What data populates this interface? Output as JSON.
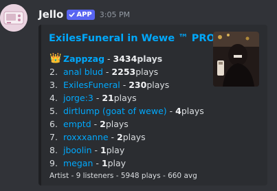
{
  "author": {
    "name": "Jello",
    "badge": "APP",
    "timestamp": "3:05 PM"
  },
  "embed": {
    "title": "ExilesFuneral in Wewe ™ PRO",
    "rows": [
      {
        "rank": "👑",
        "user": "Zappzag",
        "sep": " - ",
        "count": "3434",
        "unit": " plays"
      },
      {
        "rank": "2.",
        "user": "anal blud",
        "sep": " - ",
        "count": "2253",
        "unit": " plays"
      },
      {
        "rank": "3.",
        "user": "ExilesFuneral",
        "sep": " - ",
        "count": "230",
        "unit": " plays"
      },
      {
        "rank": "4.",
        "user": "jorge:3",
        "sep": " - ",
        "count": "21",
        "unit": " plays"
      },
      {
        "rank": "5.",
        "user": "dirtlump (goat of wewe)",
        "sep": " - ",
        "count": "4",
        "unit": " plays"
      },
      {
        "rank": "6.",
        "user": "emptd",
        "sep": " - ",
        "count": "2",
        "unit": " plays"
      },
      {
        "rank": "7.",
        "user": "roxxxanne",
        "sep": " - ",
        "count": "2",
        "unit": " plays"
      },
      {
        "rank": "8.",
        "user": "jboolin",
        "sep": " - ",
        "count": "1",
        "unit": " play"
      },
      {
        "rank": "9.",
        "user": "megan",
        "sep": " - ",
        "count": "1",
        "unit": " play"
      }
    ],
    "footer": "Artist - 9 listeners - 5948 plays - 660 avg"
  },
  "colors": {
    "background": "#313338",
    "embed_background": "#2b2d31",
    "link": "#00a8fc",
    "badge": "#5865f2"
  },
  "icons": {
    "badge_check": "check-icon"
  }
}
